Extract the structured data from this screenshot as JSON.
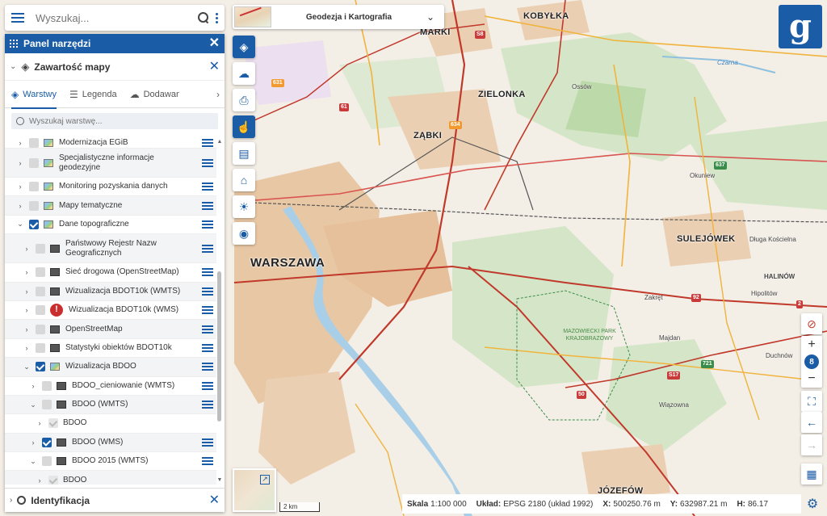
{
  "search": {
    "placeholder": "Wyszukaj..."
  },
  "panel": {
    "title": "Panel narzędzi",
    "content": {
      "title": "Zawartość mapy",
      "tabs": [
        {
          "label": "Warstwy",
          "active": true
        },
        {
          "label": "Legenda",
          "active": false
        },
        {
          "label": "Dodawanie",
          "active": false
        }
      ],
      "layer_search_placeholder": "Wyszukaj warstwę..."
    },
    "layers": [
      {
        "name": "Modernizacja EGiB",
        "checked": false
      },
      {
        "name": "Specjalistyczne informacje geodezyjne",
        "checked": false
      },
      {
        "name": "Monitoring pozyskania danych",
        "checked": false
      },
      {
        "name": "Mapy tematyczne",
        "checked": false
      },
      {
        "name": "Dane topograficzne",
        "checked": true
      },
      {
        "name": "Państwowy Rejestr Nazw Geograficznych",
        "checked": false
      },
      {
        "name": "Sieć drogowa (OpenStreetMap)",
        "checked": false
      },
      {
        "name": "Wizualizacja BDOT10k (WMTS)",
        "checked": false
      },
      {
        "name": "Wizualizacja BDOT10k (WMS)",
        "checked": false
      },
      {
        "name": "OpenStreetMap",
        "checked": false
      },
      {
        "name": "Statystyki obiektów BDOT10k",
        "checked": false
      },
      {
        "name": "Wizualizacja BDOO",
        "checked": true
      },
      {
        "name": "BDOO_cieniowanie (WMTS)",
        "checked": false
      },
      {
        "name": "BDOO (WMTS)",
        "checked": false
      },
      {
        "name": "BDOO",
        "checked": true
      },
      {
        "name": "BDOO (WMS)",
        "checked": true
      },
      {
        "name": "BDOO 2015 (WMTS)",
        "checked": false
      },
      {
        "name": "BDOO",
        "checked": true
      }
    ],
    "identification": {
      "title": "Identyfikacja"
    }
  },
  "theme": {
    "label": "Geodezja i Kartografia"
  },
  "zoom": {
    "level": "8",
    "plus": "+",
    "minus": "−"
  },
  "map_labels": {
    "warszawa": "WARSZAWA",
    "marki": "MARKI",
    "kobylka": "KOBYŁKA",
    "zielonka": "ZIELONKA",
    "zabki": "ZĄBKI",
    "sulejowek": "SULEJÓWEK",
    "jozefow": "JÓZEFÓW",
    "halinow": "HALINÓW",
    "park": "MAZOWIECKI PARK KRAJOBRAZOWY",
    "dluga": "Długa Kościelna",
    "zakret": "Zakręt",
    "majdan": "Majdan",
    "okuniew": "Okuniew",
    "ossow": "Ossów",
    "czarna": "Czarna",
    "wiazowna": "Wiązowna",
    "hipolitow": "Hipolitów",
    "duchnow": "Duchnów",
    "scale_bar": "2 km"
  },
  "road_shields": {
    "r8": "S8",
    "r631": "631",
    "r634": "634",
    "r637": "637",
    "r2": "2",
    "r17": "S17",
    "r721": "721",
    "r92": "92",
    "r61": "61",
    "r50": "50"
  },
  "status": {
    "scale_label": "Skala",
    "scale_value": "1:100 000",
    "layout_label": "Układ:",
    "layout_value": "EPSG 2180 (układ 1992)",
    "x_label": "X:",
    "x_value": "500250.76 m",
    "y_label": "Y:",
    "y_value": "632987.21 m",
    "h_label": "H:",
    "h_value": "86.17"
  },
  "colors": {
    "accent": "#1a5ca6",
    "urban": "#e8c4a0",
    "forest": "#cfe3c3",
    "water": "#a9cfe8",
    "major_road": "#c0392b"
  },
  "logo_text": "g"
}
